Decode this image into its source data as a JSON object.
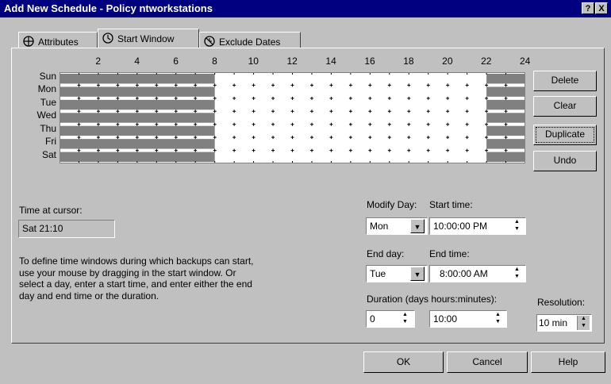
{
  "window": {
    "title": "Add New Schedule - Policy ntworkstations",
    "help_btn": "?",
    "close_btn": "X"
  },
  "tabs": [
    {
      "label": "Attributes"
    },
    {
      "label": "Start Window"
    },
    {
      "label": "Exclude Dates"
    }
  ],
  "grid": {
    "hour_labels": [
      "2",
      "4",
      "6",
      "8",
      "10",
      "12",
      "14",
      "16",
      "18",
      "20",
      "22",
      "24"
    ],
    "days": [
      "Sun",
      "Mon",
      "Tue",
      "Wed",
      "Thu",
      "Fri",
      "Sat"
    ],
    "windows": [
      {
        "day": "Sun",
        "ranges": [
          [
            0,
            8
          ],
          [
            22,
            24
          ]
        ]
      },
      {
        "day": "Mon",
        "ranges": [
          [
            0,
            8
          ],
          [
            22,
            24
          ]
        ]
      },
      {
        "day": "Tue",
        "ranges": [
          [
            0,
            8
          ],
          [
            22,
            24
          ]
        ]
      },
      {
        "day": "Wed",
        "ranges": [
          [
            0,
            8
          ],
          [
            22,
            24
          ]
        ]
      },
      {
        "day": "Thu",
        "ranges": [
          [
            0,
            8
          ],
          [
            22,
            24
          ]
        ]
      },
      {
        "day": "Fri",
        "ranges": [
          [
            0,
            8
          ],
          [
            22,
            24
          ]
        ]
      },
      {
        "day": "Sat",
        "ranges": [
          [
            0,
            8
          ],
          [
            22,
            24
          ]
        ]
      }
    ],
    "bar_color": "#808080"
  },
  "side_buttons": {
    "delete": "Delete",
    "clear": "Clear",
    "duplicate": "Duplicate",
    "undo": "Undo"
  },
  "cursor": {
    "label": "Time at cursor:",
    "value": "Sat 21:10"
  },
  "instructions": [
    "To define time windows during which backups can start,",
    "use your mouse by dragging in the start window.  Or",
    "select a day, enter a start time, and enter either the end",
    "day and end time or the duration."
  ],
  "form": {
    "modify_day_label": "Modify Day:",
    "modify_day_value": "Mon",
    "start_time_label": "Start time:",
    "start_time_value": "10:00:00 PM",
    "end_day_label": "End day:",
    "end_day_value": "Tue",
    "end_time_label": "End time:",
    "end_time_value": "8:00:00 AM",
    "duration_label": "Duration (days hours:minutes):",
    "duration_days": "0",
    "duration_time": "10:00",
    "resolution_label": "Resolution:",
    "resolution_value": "10 min"
  },
  "footer": {
    "ok": "OK",
    "cancel": "Cancel",
    "help": "Help"
  }
}
